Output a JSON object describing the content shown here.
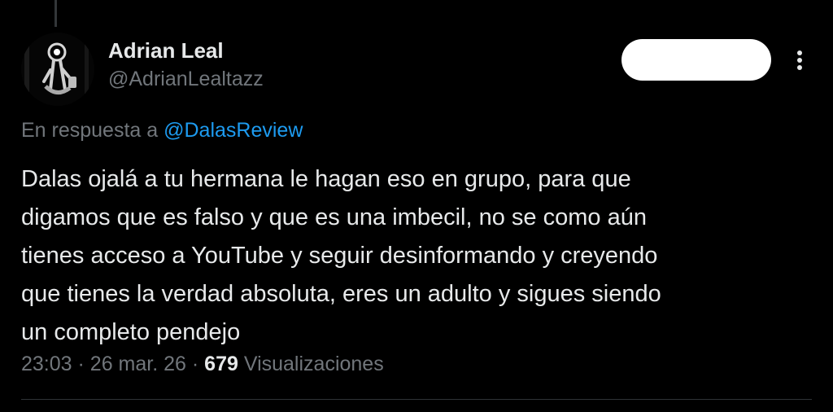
{
  "tweet": {
    "author_name": "Adrian Leal",
    "author_handle": "@AdrianLealtazz",
    "avatar_icon": "avatar-photo",
    "follow_button_label": "",
    "more_icon": "more-vertical-icon",
    "reply_prefix": "En respuesta a",
    "reply_mention": "@DalasReview",
    "text": "Dalas ojalá a tu hermana le hagan eso en grupo, para que\ndigamos que es falso y que es una imbecil, no se como aún\ntienes acceso a YouTube y seguir desinformando y creyendo\nque tienes la verdad absoluta, eres un adulto y sigues siendo\nun completo pendejo",
    "time": "23:03",
    "separator": "·",
    "date": "26 mar. 26",
    "views_count": "679",
    "views_label": "Visualizaciones"
  },
  "colors": {
    "background": "#000000",
    "primary_text": "#e7e9ea",
    "secondary_text": "#71767b",
    "link": "#1d9bf0",
    "divider": "#2f3336"
  }
}
